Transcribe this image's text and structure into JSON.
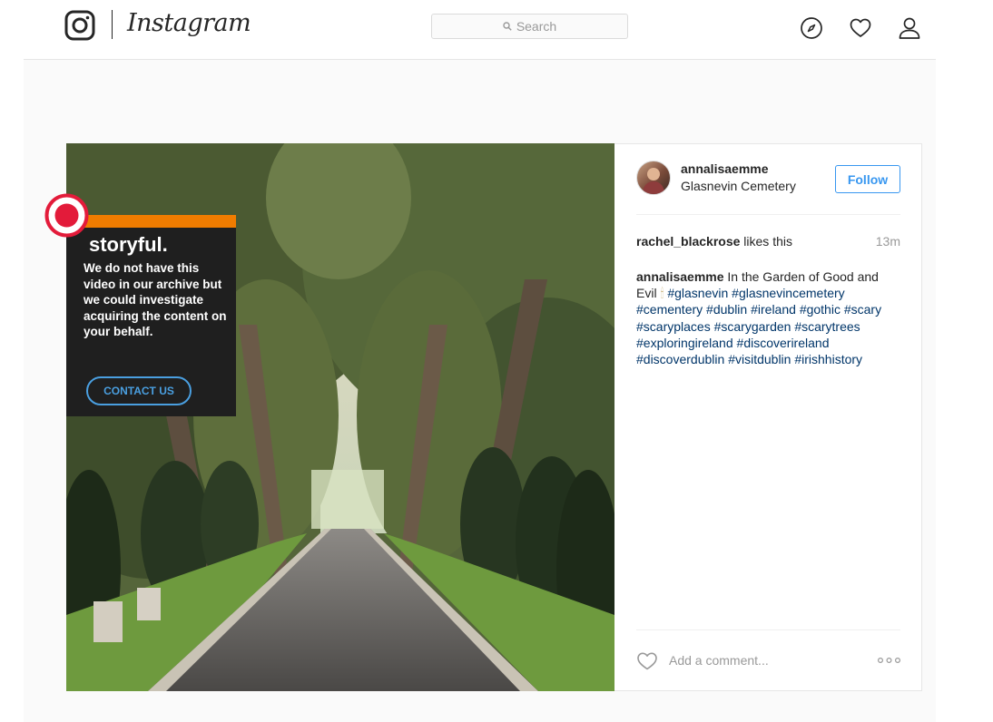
{
  "header": {
    "brand": "Instagram",
    "search_placeholder": "Search",
    "icons": [
      "instagram-glyph-icon",
      "search-icon",
      "explore-compass-icon",
      "activity-heart-icon",
      "profile-icon"
    ]
  },
  "overlay": {
    "brand": "storyful.",
    "message": "We do not have this video in our archive but we could investigate acquiring the content on your behalf.",
    "button_label": "CONTACT US",
    "accent_color": "#f07c00",
    "record_color": "#e31b3a"
  },
  "post": {
    "username": "annalisaemme",
    "location": "Glasnevin Cemetery",
    "follow_label": "Follow",
    "likes_user": "rachel_blackrose",
    "likes_suffix": " likes this",
    "time_ago": "13m",
    "caption": {
      "username": "annalisaemme",
      "text": "In the Garden of Good and Evil",
      "emoji": "🕯",
      "hashtags": [
        "#glasnevin",
        "#glasnevincemetery",
        "#cementery",
        "#dublin",
        "#ireland",
        "#gothic",
        "#scary",
        "#scaryplaces",
        "#scarygarden",
        "#scarytrees",
        "#exploringireland",
        "#discoverireland",
        "#discoverdublin",
        "#visitdublin",
        "#irishhistory"
      ]
    },
    "comment_placeholder": "Add a comment...",
    "link_color": "#003569",
    "follow_color": "#3897f0"
  }
}
